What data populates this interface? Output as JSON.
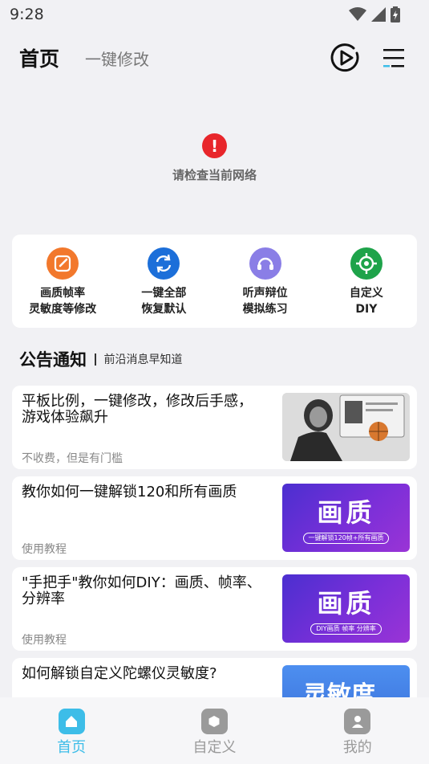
{
  "status_bar": {
    "time": "9:28"
  },
  "header": {
    "title": "首页",
    "tab": "一键修改"
  },
  "network": {
    "message": "请检查当前网络"
  },
  "quick_actions": [
    {
      "line1": "画质帧率",
      "line2": "灵敏度等修改",
      "color": "#f2782c",
      "icon": "edit-icon"
    },
    {
      "line1": "一键全部",
      "line2": "恢复默认",
      "color": "#1c6fd9",
      "icon": "refresh-icon"
    },
    {
      "line1": "听声辩位",
      "line2": "模拟练习",
      "color": "#7b6de0",
      "icon": "headset-icon"
    },
    {
      "line1": "自定义",
      "line2": "DIY",
      "color": "#1ea34a",
      "icon": "target-icon"
    }
  ],
  "notice": {
    "title": "公告通知",
    "subtitle": "前沿消息早知道"
  },
  "articles": [
    {
      "title": "平板比例，一键修改，修改后手感，游戏体验飙升",
      "tag": "不收费，但是有门槛"
    },
    {
      "title": "教你如何一键解锁120和所有画质",
      "tag": "使用教程",
      "thumb_big": "画质",
      "thumb_small": "一键解锁120帧+所有画质"
    },
    {
      "title": "\"手把手\"教你如何DIY：画质、帧率、分辨率",
      "tag": "使用教程",
      "thumb_big": "画质",
      "thumb_small": "DIY画质 帧率 分辨率"
    },
    {
      "title": "如何解锁自定义陀螺仪灵敏度?",
      "tag": "",
      "thumb_big": "灵敏度"
    }
  ],
  "tabbar": [
    {
      "label": "首页",
      "active": true
    },
    {
      "label": "自定义",
      "active": false
    },
    {
      "label": "我的",
      "active": false
    }
  ],
  "colors": {
    "accent": "#3dbde8",
    "error": "#e8262b",
    "inactive": "#9a9a9a"
  }
}
